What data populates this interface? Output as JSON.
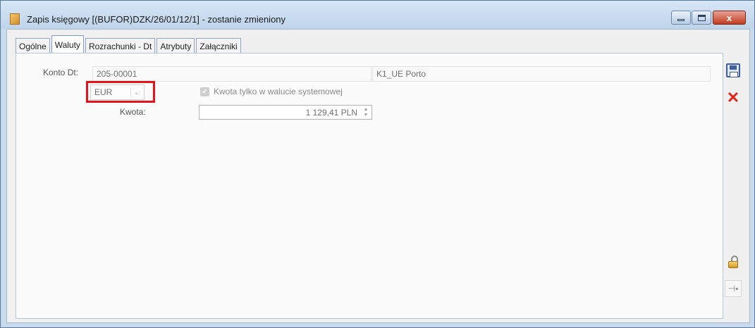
{
  "window": {
    "title": "Zapis księgowy [(BUFOR)DZK/26/01/12/1] - zostanie zmieniony",
    "close_label": "x"
  },
  "tabs": [
    {
      "label": "Ogólne",
      "active": false
    },
    {
      "label": "Waluty",
      "active": true
    },
    {
      "label": "Rozrachunki - Dt",
      "active": false
    },
    {
      "label": "Atrybuty",
      "active": false
    },
    {
      "label": "Załączniki",
      "active": false
    }
  ],
  "form": {
    "konto_label": "Konto Dt:",
    "konto_value": "205-00001",
    "konto_name_value": "K1_UE Porto",
    "currency_value": "EUR",
    "checkbox_label": "Kwota tylko w walucie systemowej",
    "checkbox_checked": true,
    "kwota_label": "Kwota:",
    "kwota_value": "1 129,41 PLN"
  },
  "icons": {
    "save": "save-icon",
    "cancel": "close-icon",
    "lock": "unlock-icon",
    "pin": "pin-icon"
  },
  "colors": {
    "highlight": "#e8121b",
    "accent": "#3f5e9e"
  }
}
